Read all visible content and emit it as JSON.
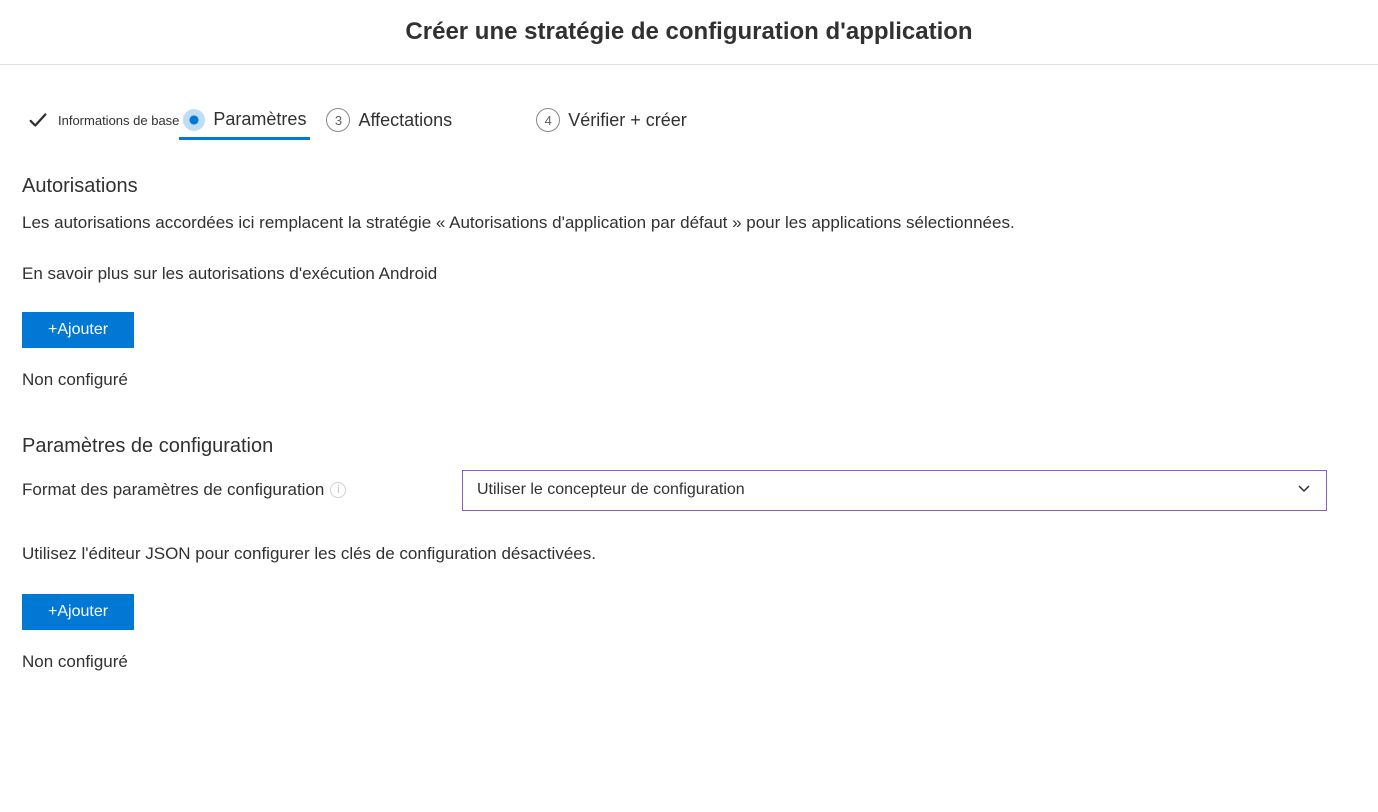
{
  "page": {
    "title": "Créer une stratégie de configuration d'application"
  },
  "stepper": {
    "steps": [
      {
        "label": "Informations de base",
        "status": "done"
      },
      {
        "label": "Paramètres",
        "status": "active"
      },
      {
        "label": "Affectations",
        "number": "3",
        "status": "upcoming"
      },
      {
        "label": "Vérifier + créer",
        "number": "4",
        "status": "upcoming"
      }
    ]
  },
  "permissions": {
    "heading": "Autorisations",
    "description": "Les autorisations accordées ici remplacent la stratégie « Autorisations d'application par défaut » pour les applications sélectionnées.",
    "learn_more": "En savoir plus sur les autorisations d'exécution Android",
    "add_button": "+Ajouter",
    "status": "Non configuré"
  },
  "config_settings": {
    "heading": "Paramètres de configuration",
    "format_label": "Format des paramètres de configuration",
    "format_value": "Utiliser le concepteur de configuration",
    "json_hint": "Utilisez l'éditeur JSON pour configurer les clés de configuration désactivées.",
    "add_button": "+Ajouter",
    "status": "Non configuré"
  },
  "colors": {
    "primary": "#0078d4",
    "dropdown_border": "#8661c5"
  }
}
